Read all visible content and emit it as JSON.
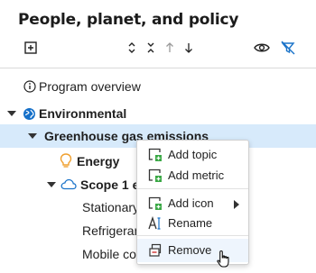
{
  "panel": {
    "title": "People, planet, and policy"
  },
  "toolbar": {
    "icons": [
      "add-square-icon",
      "expand-all-icon",
      "collapse-all-icon",
      "arrow-up-icon",
      "arrow-down-icon",
      "eye-icon",
      "filter-off-icon"
    ]
  },
  "tree": {
    "program_overview": "Program overview",
    "environmental": "Environmental",
    "greenhouse": "Greenhouse gas emissions",
    "energy": "Energy",
    "scope1": "Scope 1 emi",
    "stationary": "Stationary",
    "refrigerant": "Refrigerant",
    "mobile": "Mobile com"
  },
  "context_menu": {
    "add_topic": "Add topic",
    "add_metric": "Add metric",
    "add_icon": "Add icon",
    "rename": "Rename",
    "remove": "Remove"
  },
  "colors": {
    "accent": "#1a73c9",
    "selected_row": "#d7eafb",
    "add_icon_green": "#3aa845",
    "energy_icon_orange": "#f0a030",
    "globe_blue": "#1570c9"
  }
}
